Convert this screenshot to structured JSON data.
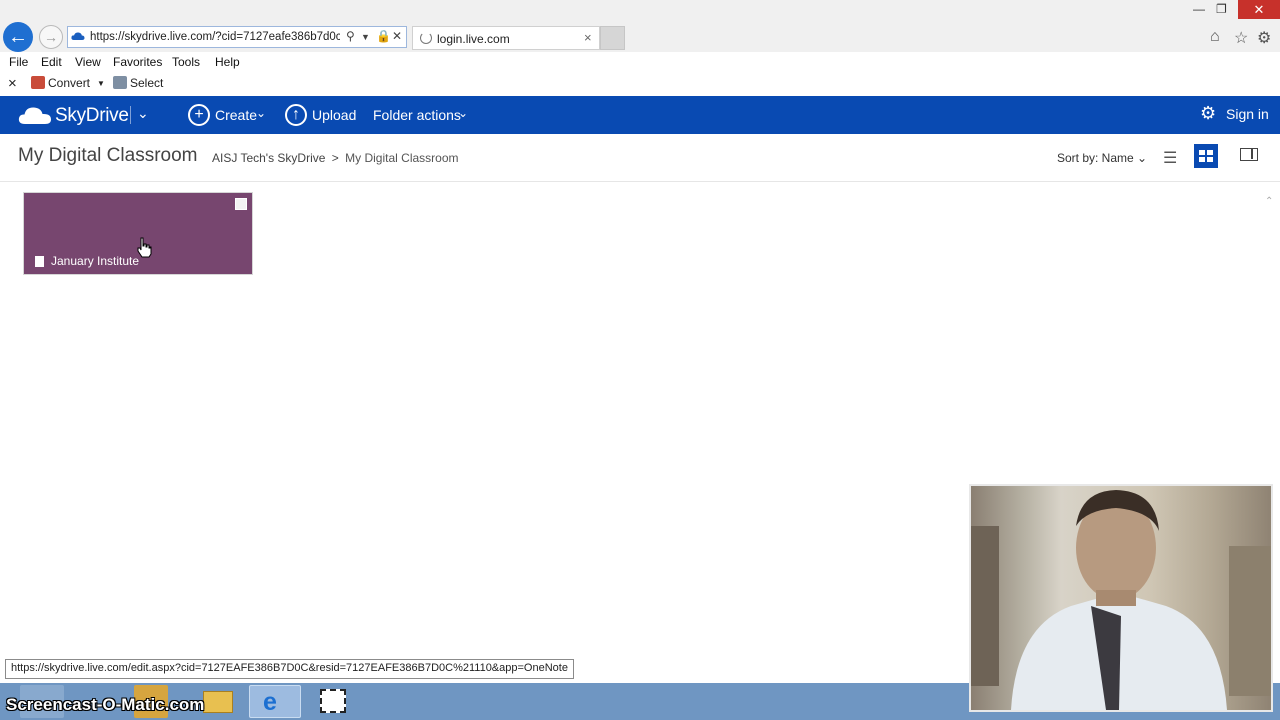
{
  "browser": {
    "url": "https://skydrive.live.com/?cid=7127eafe386b7d0c&",
    "tab_title": "login.live.com",
    "menu": [
      "File",
      "Edit",
      "View",
      "Favorites",
      "Tools",
      "Help"
    ],
    "cmd": {
      "close_glyph": "×",
      "convert_label": "Convert",
      "select_label": "Select"
    }
  },
  "skydrive": {
    "brand": "SkyDrive",
    "create_label": "Create",
    "upload_label": "Upload",
    "folder_actions_label": "Folder actions",
    "signin_label": "Sign in",
    "accent": "#094ab2"
  },
  "page": {
    "title": "My Digital Classroom",
    "breadcrumb": {
      "root": "AISJ Tech's SkyDrive",
      "separator": ">",
      "current": "My Digital Classroom"
    },
    "sort_label": "Sort by: Name"
  },
  "tiles": [
    {
      "label": "January Institute",
      "color": "#77466f",
      "type": "OneNote notebook"
    }
  ],
  "status_tip": "https://skydrive.live.com/edit.aspx?cid=7127EAFE386B7D0C&resid=7127EAFE386B7D0C%21110&app=OneNote",
  "watermark": "Screencast-O-Matic.com"
}
